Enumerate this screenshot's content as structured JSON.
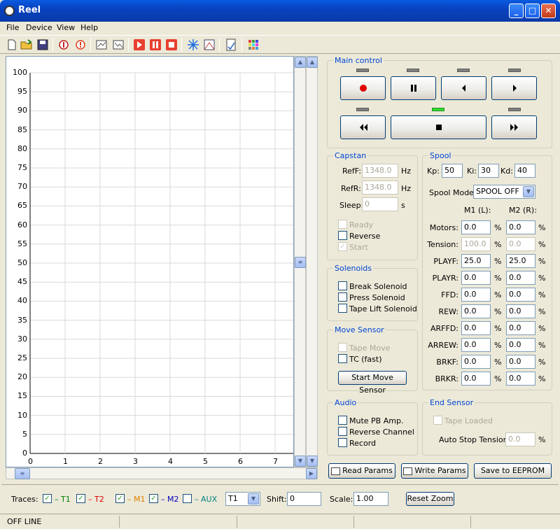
{
  "window": {
    "title": "Reel"
  },
  "menu": [
    "File",
    "Device",
    "View",
    "Help"
  ],
  "graph": {
    "y_ticks": [
      "100",
      "95",
      "90",
      "85",
      "80",
      "75",
      "70",
      "65",
      "60",
      "55",
      "50",
      "45",
      "40",
      "35",
      "30",
      "25",
      "20",
      "15",
      "10",
      "5",
      "0"
    ],
    "x_ticks": [
      "0",
      "1",
      "2",
      "3",
      "4",
      "5",
      "6",
      "7"
    ]
  },
  "main_control": {
    "label": "Main control",
    "active_led": "stop"
  },
  "capstan": {
    "label": "Capstan",
    "ref_f_label": "RefF:",
    "ref_f_value": "1348.0",
    "ref_f_unit": "Hz",
    "ref_r_label": "RefR:",
    "ref_r_value": "1348.0",
    "ref_r_unit": "Hz",
    "sleep_label": "Sleep:",
    "sleep_value": "0",
    "sleep_unit": "s",
    "ready_label": "Ready",
    "reverse_label": "Reverse",
    "start_label": "Start"
  },
  "solenoids": {
    "label": "Solenoids",
    "break": "Break Solenoid",
    "press": "Press Solenoid",
    "tape_lift": "Tape Lift Solenoid"
  },
  "move_sensor": {
    "label": "Move Sensor",
    "tape_move": "Tape Move",
    "tc_fast": "TC (fast)",
    "start_button": "Start Move Sensor"
  },
  "audio": {
    "label": "Audio",
    "mute": "Mute PB Amp.",
    "reverse": "Reverse Channel",
    "record": "Record"
  },
  "spool": {
    "label": "Spool",
    "kp_label": "Kp:",
    "kp_value": "50",
    "ki_label": "Ki:",
    "ki_value": "30",
    "kd_label": "Kd:",
    "kd_value": "40",
    "mode_label": "Spool Mode:",
    "mode_value": "SPOOL OFF",
    "col_m1": "M1 (L):",
    "col_m2": "M2 (R):",
    "unit": "%",
    "rows": [
      {
        "label": "Motors:",
        "m1": "0.0",
        "m2": "0.0"
      },
      {
        "label": "Tension:",
        "m1": "100.0",
        "m2": "0.0"
      },
      {
        "label": "PLAYF:",
        "m1": "25.0",
        "m2": "25.0"
      },
      {
        "label": "PLAYR:",
        "m1": "0.0",
        "m2": "0.0"
      },
      {
        "label": "FFD:",
        "m1": "0.0",
        "m2": "0.0"
      },
      {
        "label": "REW:",
        "m1": "0.0",
        "m2": "0.0"
      },
      {
        "label": "ARFFD:",
        "m1": "0.0",
        "m2": "0.0"
      },
      {
        "label": "ARREW:",
        "m1": "0.0",
        "m2": "0.0"
      },
      {
        "label": "BRKF:",
        "m1": "0.0",
        "m2": "0.0"
      },
      {
        "label": "BRKR:",
        "m1": "0.0",
        "m2": "0.0"
      }
    ]
  },
  "end_sensor": {
    "label": "End Sensor",
    "tape_loaded": "Tape Loaded",
    "auto_stop_label": "Auto Stop Tension:",
    "auto_stop_value": "0.0",
    "unit": "%"
  },
  "params": {
    "read": "Read Params",
    "write": "Write Params",
    "save": "Save to EEPROM"
  },
  "traces": {
    "label": "Traces:",
    "t1": "– T1",
    "t2": "– T2",
    "m1": "– M1",
    "m2": "– M2",
    "aux": "– AUX",
    "colors": {
      "t1": "#008000",
      "t2": "#e00000",
      "m1": "#e08000",
      "m2": "#0000c0",
      "aux": "#008080"
    },
    "select_value": "T1",
    "shift_label": "Shift:",
    "shift_value": "0",
    "scale_label": "Scale:",
    "scale_value": "1.00",
    "reset_zoom": "Reset Zoom"
  },
  "status": {
    "text": "OFF LINE"
  }
}
